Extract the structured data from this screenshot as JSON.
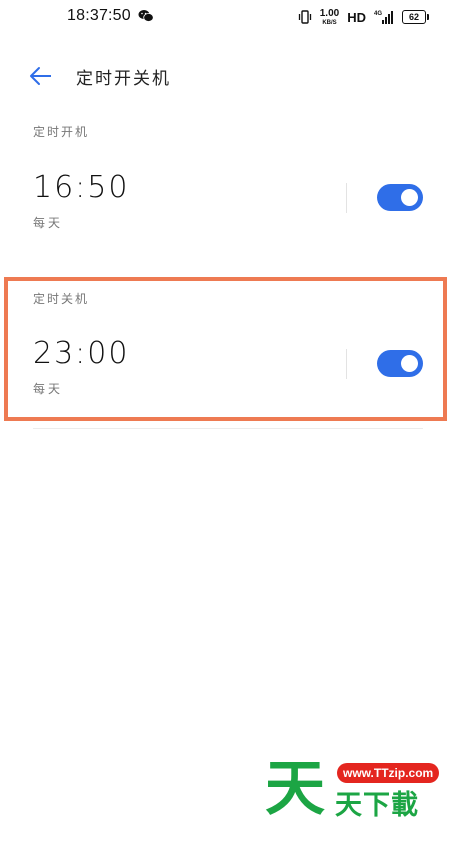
{
  "status_bar": {
    "time": "18:37:50",
    "net_speed_value": "1.00",
    "net_speed_unit": "KB/S",
    "hd": "HD",
    "network": "4G",
    "battery": "62"
  },
  "header": {
    "title": "定时开关机"
  },
  "power_on": {
    "section_label": "定时开机",
    "time": "16:50",
    "repeat": "每天",
    "enabled": true
  },
  "power_off": {
    "section_label": "定时关机",
    "time": "23:00",
    "repeat": "每天",
    "enabled": true
  },
  "watermark": {
    "big_char": "天",
    "url": "www.TTzip.com",
    "text": "天下載"
  },
  "colors": {
    "accent": "#2f6ee8",
    "highlight": "#ee7a52",
    "watermark_green": "#1ca544",
    "watermark_red": "#e4261f"
  }
}
